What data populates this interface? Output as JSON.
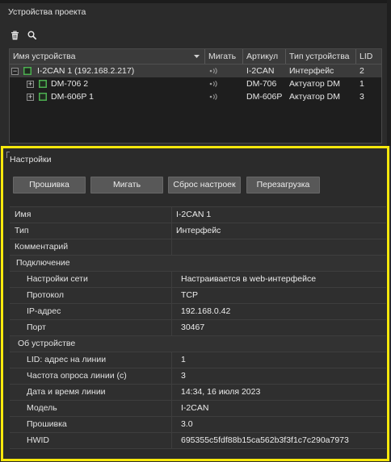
{
  "colors": {
    "highlight_border": "#f7e80c",
    "device_icon": "#4caf50",
    "selected_row": "#3b3b3b"
  },
  "devices_panel": {
    "title": "Устройства проекта",
    "toolbar_icons": [
      "trash-icon",
      "search-icon"
    ],
    "columns": {
      "name": "Имя устройства",
      "blink": "Мигать",
      "article": "Артикул",
      "type": "Тип устройства",
      "lid": "LID"
    },
    "tree": [
      {
        "expander": "−",
        "icon": "device-icon",
        "name": "I-2CAN 1 (192.168.2.217)",
        "blink_icon": "signal-icon",
        "article": "I-2CAN",
        "type": "Интерфейс",
        "lid": "2",
        "selected": true,
        "children": [
          {
            "expander": "+",
            "icon": "device-icon",
            "name": "DM-706 2",
            "blink_icon": "signal-icon",
            "article": "DM-706",
            "type": "Актуатор DM",
            "lid": "1"
          },
          {
            "expander": "+",
            "icon": "device-icon",
            "name": "DM-606P 1",
            "blink_icon": "signal-icon",
            "article": "DM-606P",
            "type": "Актуатор DM",
            "lid": "3"
          }
        ]
      }
    ]
  },
  "settings_panel": {
    "title": "Настройки",
    "buttons": {
      "firmware": "Прошивка",
      "blink": "Мигать",
      "reset": "Сброс настроек",
      "reboot": "Перезагрузка"
    },
    "properties": {
      "general": [
        {
          "label": "Имя",
          "value": "I-2CAN 1"
        },
        {
          "label": "Тип",
          "value": "Интерфейс"
        },
        {
          "label": "Комментарий",
          "value": ""
        }
      ],
      "connection": {
        "title": "Подключение",
        "items": [
          {
            "label": "Настройки сети",
            "value": "Настраивается в web-интерфейсе"
          },
          {
            "label": "Протокол",
            "value": "TCP"
          },
          {
            "label": "IP-адрес",
            "value": "192.168.0.42"
          },
          {
            "label": "Порт",
            "value": "30467"
          }
        ]
      },
      "device_info": {
        "title": "Об устройстве",
        "items": [
          {
            "label": "LID: адрес на линии",
            "value": "1"
          },
          {
            "label": "Частота опроса линии (с)",
            "value": "3"
          },
          {
            "label": "Дата и время линии",
            "value": "14:34, 16 июля 2023"
          },
          {
            "label": "Модель",
            "value": "I-2CAN"
          },
          {
            "label": "Прошивка",
            "value": "3.0"
          },
          {
            "label": "HWID",
            "value": "695355c5fdf88b15ca562b3f3f1c7c290a7973"
          }
        ]
      }
    }
  }
}
